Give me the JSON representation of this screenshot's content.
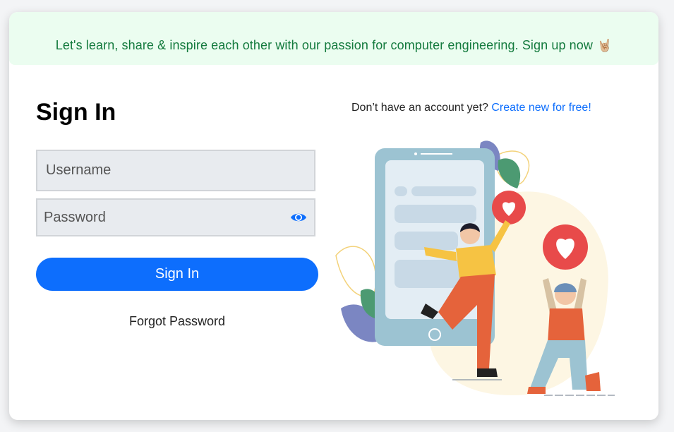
{
  "banner": {
    "text": "Let's learn, share & inspire each other with our passion for computer engineering. Sign up now",
    "emoji": "🤘🏼"
  },
  "signin": {
    "title": "Sign In",
    "username_placeholder": "Username",
    "password_placeholder": "Password",
    "button_label": "Sign In",
    "forgot_label": "Forgot Password"
  },
  "signup": {
    "prompt": "Don’t have an account yet? ",
    "link_label": "Create new for free!"
  },
  "icons": {
    "password_toggle": "eye-icon",
    "banner_emoji": "rock-on-hand-emoji"
  },
  "colors": {
    "accent": "#0d6efd",
    "banner_bg": "#ebfdf0",
    "banner_text": "#137a3d",
    "input_bg": "#e8ebef"
  }
}
